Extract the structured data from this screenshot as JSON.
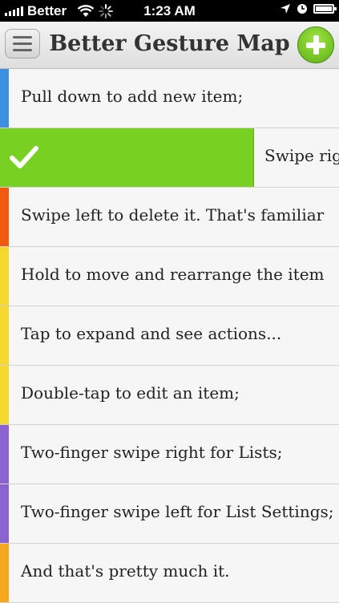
{
  "status_bar": {
    "carrier": "Better",
    "time": "1:23 AM"
  },
  "header": {
    "title": "Better Gesture Map"
  },
  "items": [
    {
      "label": "Pull down to add new item;",
      "color": "#3d8fe0"
    },
    {
      "label": "Swipe right to complete",
      "color": "#77d022",
      "swiped": true
    },
    {
      "label": "Swipe left to delete it. That's familiar",
      "color": "#f25a0f"
    },
    {
      "label": "Hold to move and rearrange the item",
      "color": "#f5d92e"
    },
    {
      "label": "Tap to expand and see actions...",
      "color": "#f5d92e"
    },
    {
      "label": "Double-tap to edit an item;",
      "color": "#f5d92e"
    },
    {
      "label": "Two-finger swipe right for Lists;",
      "color": "#8a63cf"
    },
    {
      "label": "Two-finger swipe left for List Settings;",
      "color": "#8a63cf"
    },
    {
      "label": "And that's pretty much it.",
      "color": "#f5a81d"
    }
  ]
}
